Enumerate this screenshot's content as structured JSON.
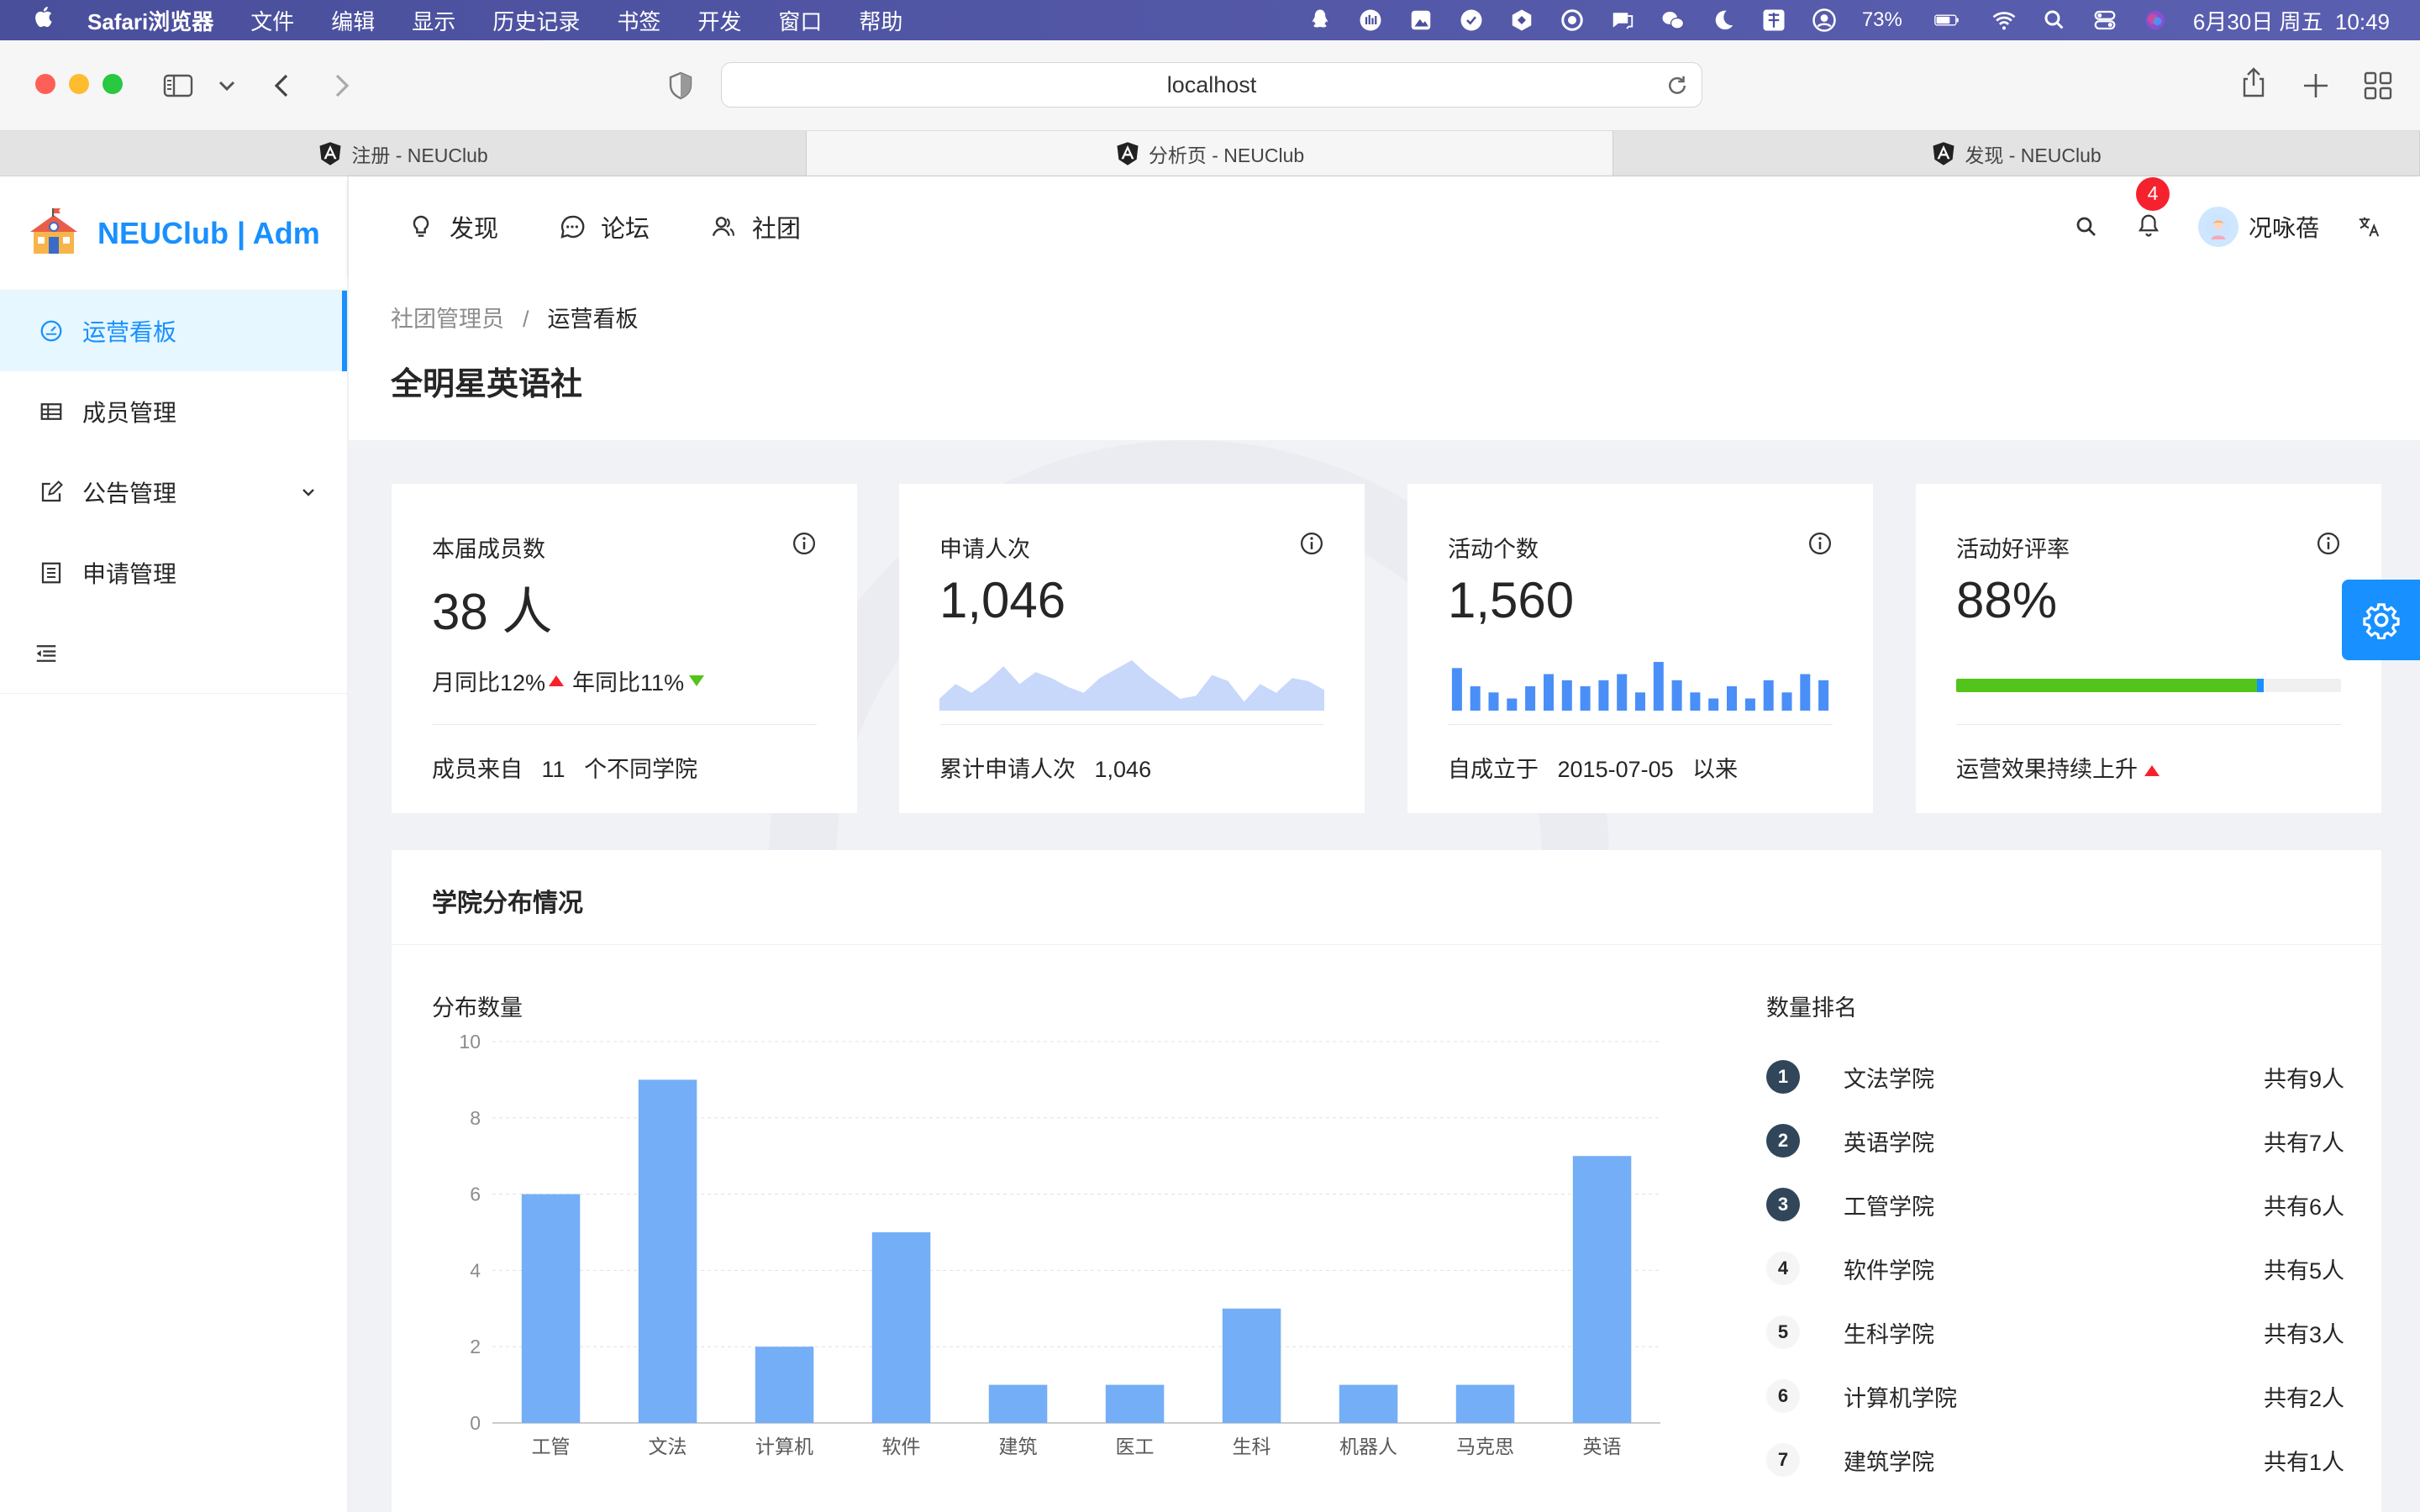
{
  "menubar": {
    "app_name": "Safari浏览器",
    "items": [
      "文件",
      "编辑",
      "显示",
      "历史记录",
      "书签",
      "开发",
      "窗口",
      "帮助"
    ],
    "battery": "73%",
    "datetime": "6月30日 周五  10:49"
  },
  "browser": {
    "url": "localhost",
    "tabs": [
      {
        "label": "注册 - NEUClub",
        "active": false
      },
      {
        "label": "分析页 - NEUClub",
        "active": true
      },
      {
        "label": "发现 - NEUClub",
        "active": false
      }
    ]
  },
  "sidebar": {
    "logo_text": "NEUClub | Adm",
    "items": [
      {
        "label": "运营看板",
        "icon": "dashboard-icon",
        "active": true
      },
      {
        "label": "成员管理",
        "icon": "table-icon"
      },
      {
        "label": "公告管理",
        "icon": "edit-icon",
        "expandable": true
      },
      {
        "label": "申请管理",
        "icon": "list-icon"
      }
    ]
  },
  "topnav": {
    "items": [
      {
        "label": "发现",
        "icon": "bulb-icon"
      },
      {
        "label": "论坛",
        "icon": "message-icon"
      },
      {
        "label": "社团",
        "icon": "team-icon"
      }
    ],
    "notification_count": "4",
    "username": "况咏蓓"
  },
  "page": {
    "breadcrumb": [
      "社团管理员",
      "运营看板"
    ],
    "breadcrumb_sep": "/",
    "title": "全明星英语社"
  },
  "cards": [
    {
      "title": "本届成员数",
      "value": "38 人",
      "mom_label": "月同比12%",
      "yoy_label": "年同比11%",
      "footer_prefix": "成员来自",
      "footer_value": "11",
      "footer_suffix": "个不同学院"
    },
    {
      "title": "申请人次",
      "value": "1,046",
      "footer_prefix": "累计申请人次",
      "footer_value": "1,046"
    },
    {
      "title": "活动个数",
      "value": "1,560",
      "footer_prefix": "自成立于",
      "footer_value": "2015-07-05",
      "footer_suffix": "以来"
    },
    {
      "title": "活动好评率",
      "value": "88%",
      "progress": 0.8,
      "footer_text": "运营效果持续上升"
    }
  ],
  "sparklines": {
    "area": [
      4,
      9,
      6,
      10,
      15,
      9,
      13,
      11,
      8,
      6,
      11,
      14,
      17,
      12,
      8,
      4,
      5,
      12,
      10,
      3,
      9,
      6,
      11,
      10,
      7
    ],
    "bars": [
      7,
      4,
      3,
      2,
      4,
      6,
      5,
      4,
      5,
      6,
      3,
      8,
      5,
      3,
      2,
      4,
      2,
      5,
      3,
      6,
      5
    ],
    "progress_color": "#52c41a",
    "marker_color": "#1890ff"
  },
  "distribution": {
    "title": "学院分布情况",
    "chart_title": "分布数量",
    "rank_title": "数量排名",
    "ranking": [
      {
        "rank": "1",
        "name": "文法学院",
        "count": "共有9人"
      },
      {
        "rank": "2",
        "name": "英语学院",
        "count": "共有7人"
      },
      {
        "rank": "3",
        "name": "工管学院",
        "count": "共有6人"
      },
      {
        "rank": "4",
        "name": "软件学院",
        "count": "共有5人"
      },
      {
        "rank": "5",
        "name": "生科学院",
        "count": "共有3人"
      },
      {
        "rank": "6",
        "name": "计算机学院",
        "count": "共有2人"
      },
      {
        "rank": "7",
        "name": "建筑学院",
        "count": "共有1人"
      }
    ]
  },
  "chart_data": {
    "type": "bar",
    "title": "分布数量",
    "categories": [
      "工管",
      "文法",
      "计算机",
      "软件",
      "建筑",
      "医工",
      "生科",
      "机器人",
      "马克思",
      "英语"
    ],
    "values": [
      6,
      9,
      2,
      5,
      1,
      1,
      3,
      1,
      1,
      7
    ],
    "ylim": [
      0,
      10
    ],
    "yticks": [
      0,
      2,
      4,
      6,
      8,
      10
    ],
    "grid": true,
    "bar_color": "#74aef6"
  }
}
